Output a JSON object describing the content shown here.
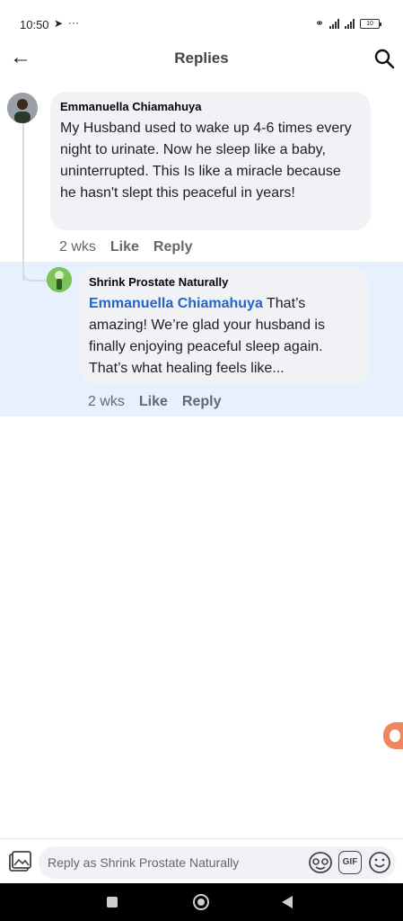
{
  "status_bar": {
    "time": "10:50",
    "send_icon": "telegram-send-icon",
    "dots": "···",
    "battery": "10"
  },
  "header": {
    "title": "Replies"
  },
  "comment": {
    "author": "Emmanuella Chiamahuya",
    "text": "My Husband used to wake up 4-6 times every night to urinate. Now he sleep like a baby, uninterrupted. This Is like a miracle because he hasn't slept this peaceful in years!",
    "time": "2 wks",
    "like_label": "Like",
    "reply_label": "Reply"
  },
  "reply": {
    "author": "Shrink Prostate Naturally",
    "mention": "Emmanuella Chiamahuya",
    "text": " That’s amazing! We’re glad your husband is finally enjoying peaceful sleep again. That’s what healing feels like...",
    "time": "2 wks",
    "like_label": "Like",
    "reply_label": "Reply"
  },
  "composer": {
    "placeholder": "Reply as Shrink Prostate Naturally",
    "gif_label": "GIF"
  },
  "colors": {
    "mention": "#2565c7",
    "highlight": "#e7f0fd",
    "bubble": "#f0f2f5",
    "side_badge": "#f0865d"
  }
}
